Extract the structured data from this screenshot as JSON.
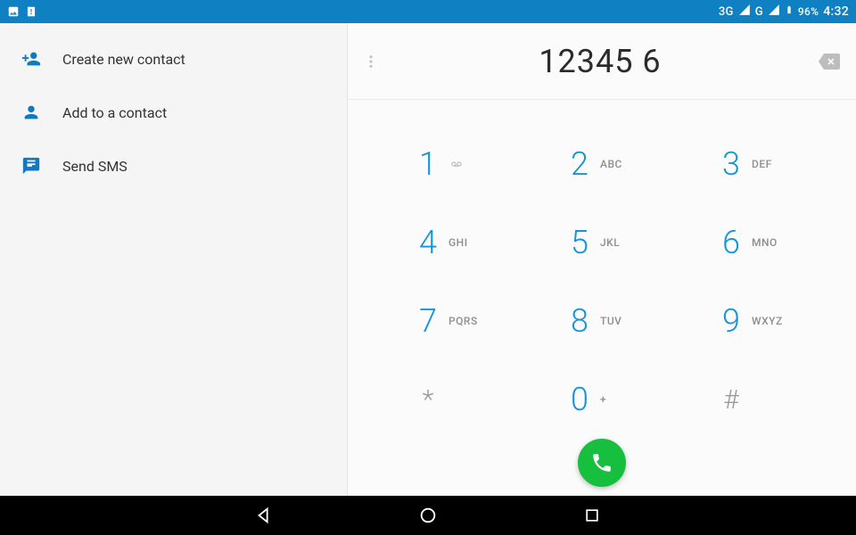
{
  "status_bar": {
    "signal1": "3G",
    "signal2": "G",
    "battery_pct": "96%",
    "clock": "4:32"
  },
  "sidebar": {
    "items": [
      {
        "label": "Create new contact"
      },
      {
        "label": "Add to a contact"
      },
      {
        "label": "Send SMS"
      }
    ]
  },
  "dialer": {
    "number": "12345 6",
    "keys": [
      {
        "digit": "1",
        "letters": ""
      },
      {
        "digit": "2",
        "letters": "ABC"
      },
      {
        "digit": "3",
        "letters": "DEF"
      },
      {
        "digit": "4",
        "letters": "GHI"
      },
      {
        "digit": "5",
        "letters": "JKL"
      },
      {
        "digit": "6",
        "letters": "MNO"
      },
      {
        "digit": "7",
        "letters": "PQRS"
      },
      {
        "digit": "8",
        "letters": "TUV"
      },
      {
        "digit": "9",
        "letters": "WXYZ"
      },
      {
        "digit": "*",
        "letters": ""
      },
      {
        "digit": "0",
        "letters": "+"
      },
      {
        "digit": "#",
        "letters": ""
      }
    ]
  },
  "colors": {
    "status_bar": "#0f80c1",
    "accent": "#1695d6",
    "call_green": "#17bf3f"
  }
}
